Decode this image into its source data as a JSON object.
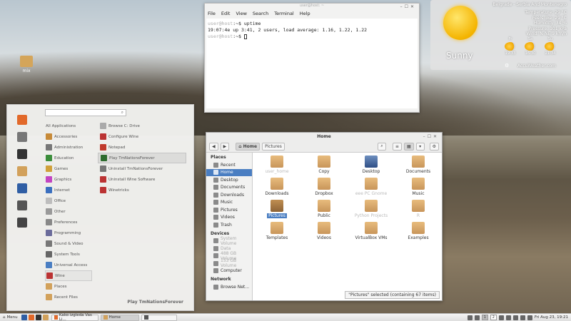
{
  "desktop": {
    "icon_label": "mix"
  },
  "terminal": {
    "title": "user@host: ~",
    "menu": [
      "File",
      "Edit",
      "View",
      "Search",
      "Terminal",
      "Help"
    ],
    "prompt_blur": "user@host",
    "line1_cmd": ":~$ uptime",
    "line2": " 19:07:4e up  3:41,  2 users,  load average: 1.16, 1.22, 1.22",
    "line3_cmd": ":~$ "
  },
  "weather": {
    "location": "Belgrade - Serbia And Montenegro",
    "stats": [
      "Temperature: 29 °C",
      "Feels like: 29 °C",
      "Humidity: 34 %",
      "Pressure: 101 kPa",
      "Wind: N-NE 9 km/h"
    ],
    "condition": "Sunny",
    "days": [
      {
        "name": "Fr",
        "range": "19-33"
      },
      {
        "name": "Sa",
        "range": "16-30"
      },
      {
        "name": "Su",
        "range": "21-34"
      }
    ],
    "source": "AccuWeather.com"
  },
  "menu": {
    "categories": [
      "All Applications",
      "Accessories",
      "Administration",
      "Education",
      "Games",
      "Graphics",
      "Internet",
      "Office",
      "Other",
      "Preferences",
      "Programming",
      "Sound & Video",
      "System Tools",
      "Universal Access",
      "Wine",
      "Places",
      "Recent Files"
    ],
    "apps": [
      "Browse C: Drive",
      "Configure Wine",
      "Notepad",
      "Play TmNationsForever",
      "Uninstall TmNationsForever",
      "Uninstall Wine Software",
      "Winetricks"
    ],
    "footer": "Play TmNationsForever"
  },
  "files": {
    "title": "Home",
    "path": [
      "Home",
      "Pictures"
    ],
    "places_header": "Places",
    "places": [
      "Recent",
      "Home",
      "Desktop",
      "Documents",
      "Downloads",
      "Music",
      "Pictures",
      "Videos",
      "Trash"
    ],
    "devices_header": "Devices",
    "devices": [
      "System Volume",
      "Data",
      "488 GB Volume",
      "153 GB Volume",
      "Computer"
    ],
    "network_header": "Network",
    "network": [
      "Browse Net..."
    ],
    "items": [
      "user_home",
      "Copy",
      "Desktop",
      "Documents",
      "Downloads",
      "Dropbox",
      "eee PC Gnome",
      "Music",
      "Pictures",
      "Public",
      "Python Projects",
      "R",
      "Templates",
      "Videos",
      "VirtualBox VMs",
      "Examples"
    ],
    "status": "\"Pictures\" selected (containing 67 items)"
  },
  "panel": {
    "menu_label": "Menu",
    "tasks": [
      "Kako izgleda Vas Li...",
      "Home",
      ""
    ],
    "workspaces": [
      "1",
      "2"
    ],
    "clock": "Fri Aug 23, 19:21"
  }
}
